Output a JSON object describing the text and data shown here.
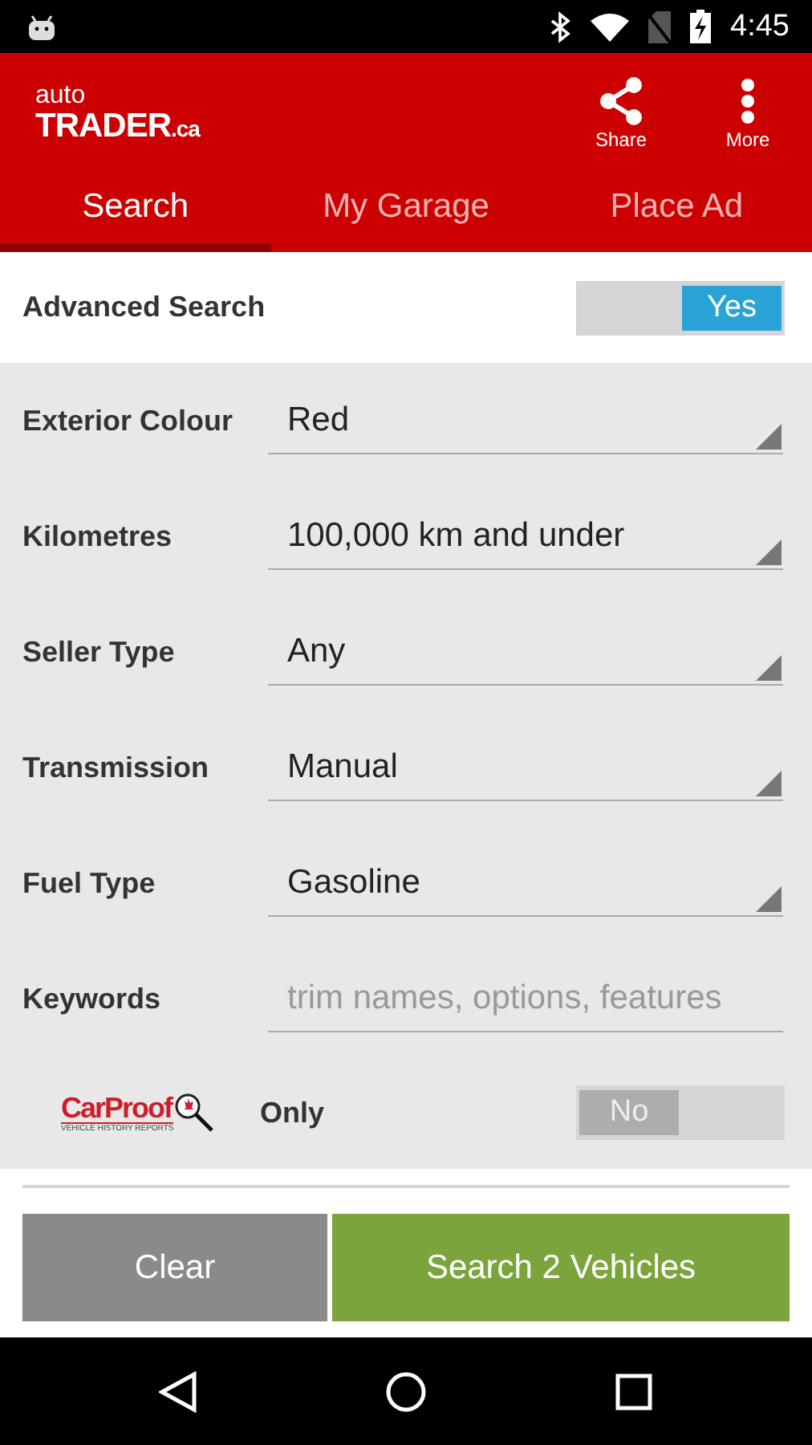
{
  "status_bar": {
    "time": "4:45"
  },
  "app_bar": {
    "logo": {
      "line1": "auto",
      "line2": "TRADER",
      "suffix": ".ca"
    },
    "actions": [
      {
        "label": "Share",
        "kind": "share"
      },
      {
        "label": "More",
        "kind": "more"
      }
    ]
  },
  "tabs": [
    {
      "label": "Search",
      "selected": true
    },
    {
      "label": "My Garage",
      "selected": false
    },
    {
      "label": "Place Ad",
      "selected": false
    }
  ],
  "advanced_search": {
    "label": "Advanced Search",
    "toggle": {
      "on": true,
      "label": "Yes"
    }
  },
  "fields": [
    {
      "label": "Exterior Colour",
      "kind": "dropdown",
      "value": "Red"
    },
    {
      "label": "Kilometres",
      "kind": "dropdown",
      "value": "100,000 km and under"
    },
    {
      "label": "Seller Type",
      "kind": "dropdown",
      "value": "Any"
    },
    {
      "label": "Transmission",
      "kind": "dropdown",
      "value": "Manual"
    },
    {
      "label": "Fuel Type",
      "kind": "dropdown",
      "value": "Gasoline"
    },
    {
      "label": "Keywords",
      "kind": "text",
      "placeholder": "trim names, options, features"
    }
  ],
  "carproof": {
    "logo": {
      "name": "CarProof",
      "tagline": "VEHICLE HISTORY REPORTS"
    },
    "label": "Only",
    "toggle": {
      "on": false,
      "label": "No"
    }
  },
  "buttons": [
    {
      "label": "Clear",
      "kind": "secondary"
    },
    {
      "label": "Search 2 Vehicles",
      "kind": "primary"
    }
  ]
}
